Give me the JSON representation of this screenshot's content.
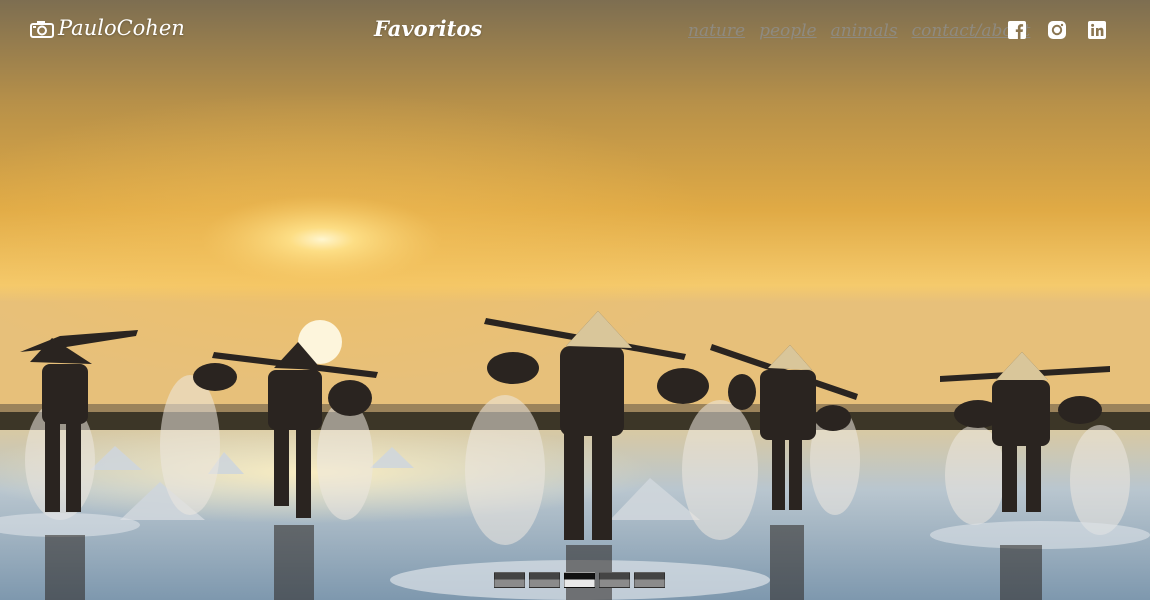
{
  "brand": {
    "name": "PauloCohen",
    "icon": "camera-icon"
  },
  "page": {
    "title": "Favoritos"
  },
  "nav": {
    "items": [
      {
        "label": "nature"
      },
      {
        "label": "people"
      },
      {
        "label": "animals"
      },
      {
        "label": "contact/about"
      }
    ]
  },
  "social": [
    {
      "icon": "facebook-icon"
    },
    {
      "icon": "instagram-icon"
    },
    {
      "icon": "linkedin-icon"
    }
  ],
  "slider": {
    "slides": 5,
    "active": 3
  },
  "colors": {
    "sky_top": "#8d7c57",
    "sky_mid": "#dca63f",
    "sky_horizon": "#f3c767",
    "water": "#a9bfd0",
    "nav_link": "#8e8a80",
    "text": "#ffffff"
  }
}
